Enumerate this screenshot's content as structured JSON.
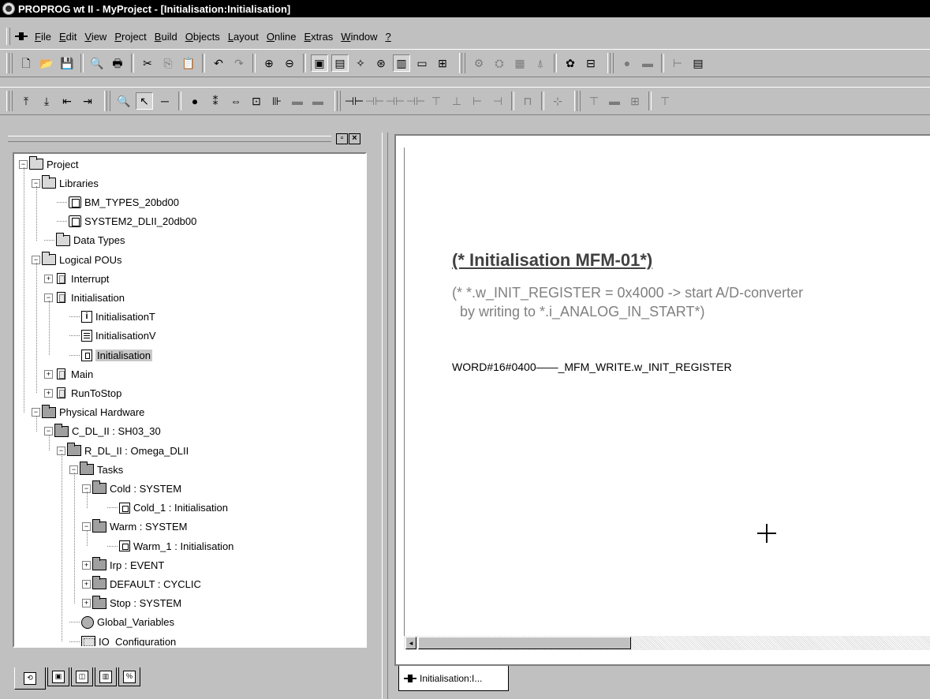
{
  "window": {
    "title": "PROPROG wt II - MyProject - [Initialisation:Initialisation]"
  },
  "menu": [
    {
      "id": "file",
      "label": "File"
    },
    {
      "id": "edit",
      "label": "Edit"
    },
    {
      "id": "view",
      "label": "View"
    },
    {
      "id": "project",
      "label": "Project"
    },
    {
      "id": "build",
      "label": "Build"
    },
    {
      "id": "objects",
      "label": "Objects"
    },
    {
      "id": "layout",
      "label": "Layout"
    },
    {
      "id": "online",
      "label": "Online"
    },
    {
      "id": "extras",
      "label": "Extras"
    },
    {
      "id": "window",
      "label": "Window"
    },
    {
      "id": "help",
      "label": "?"
    }
  ],
  "toolbar1": [
    {
      "name": "new-icon",
      "glyph": "🗋"
    },
    {
      "name": "open-icon",
      "glyph": "📂"
    },
    {
      "name": "save-icon",
      "glyph": "💾"
    },
    {
      "sep": true
    },
    {
      "name": "print-preview-icon",
      "glyph": "🔍"
    },
    {
      "name": "print-icon",
      "glyph": "🖶"
    },
    {
      "sep": true
    },
    {
      "name": "cut-icon",
      "glyph": "✂"
    },
    {
      "name": "copy-icon",
      "glyph": "⎘",
      "muted": true
    },
    {
      "name": "paste-icon",
      "glyph": "📋"
    },
    {
      "sep": true
    },
    {
      "name": "undo-icon",
      "glyph": "↶"
    },
    {
      "name": "redo-icon",
      "glyph": "↷",
      "muted": true
    },
    {
      "sep": true
    },
    {
      "name": "zoom-in-icon",
      "glyph": "⊕"
    },
    {
      "name": "zoom-out-icon",
      "glyph": "⊖"
    },
    {
      "sep": true
    },
    {
      "name": "project-tree-window-icon",
      "glyph": "▣",
      "pressed": true
    },
    {
      "name": "message-window-icon",
      "glyph": "▤",
      "pressed": true
    },
    {
      "name": "wizard-icon",
      "glyph": "✧"
    },
    {
      "name": "library-view-icon",
      "glyph": "⊛"
    },
    {
      "name": "task-view-icon",
      "glyph": "▥",
      "pressed": true
    },
    {
      "name": "window-icon",
      "glyph": "▭"
    },
    {
      "name": "compile-icon",
      "glyph": "⊞"
    },
    {
      "grip": true
    },
    {
      "name": "make-icon",
      "glyph": "⚙",
      "muted": true
    },
    {
      "name": "build-project-icon",
      "glyph": "⛭",
      "muted": true
    },
    {
      "name": "hardware-icon",
      "glyph": "▦",
      "muted": true
    },
    {
      "name": "download-icon",
      "glyph": "⍋",
      "muted": true
    },
    {
      "sep": true
    },
    {
      "name": "debug-icon",
      "glyph": "✿"
    },
    {
      "name": "monitor-icon",
      "glyph": "⊟"
    },
    {
      "grip": true
    },
    {
      "name": "run-icon",
      "glyph": "●",
      "muted": true
    },
    {
      "name": "stop-icon",
      "glyph": "▬",
      "muted": true
    },
    {
      "sep": true
    },
    {
      "name": "contact-icon",
      "glyph": "⊢",
      "muted": true
    },
    {
      "name": "terminal-icon",
      "glyph": "▤"
    }
  ],
  "toolbar2": [
    {
      "name": "insert-above-icon",
      "glyph": "⤒"
    },
    {
      "name": "insert-below-icon",
      "glyph": "⤓"
    },
    {
      "name": "insert-left-icon",
      "glyph": "⇤"
    },
    {
      "name": "insert-right-icon",
      "glyph": "⇥"
    },
    {
      "grip": true
    },
    {
      "name": "find-icon",
      "glyph": "🔍"
    },
    {
      "name": "select-pointer-icon",
      "glyph": "↖",
      "pressed": true
    },
    {
      "name": "line-tool-icon",
      "glyph": "─"
    },
    {
      "sep": true
    },
    {
      "name": "variable-icon",
      "glyph": "⦁"
    },
    {
      "name": "connector-icon",
      "glyph": "⁑"
    },
    {
      "name": "jump-icon",
      "glyph": "⇔"
    },
    {
      "name": "insert-fb-icon",
      "glyph": "⊡"
    },
    {
      "name": "function-block-icon",
      "glyph": "⊪"
    },
    {
      "name": "block-disabled-1-icon",
      "glyph": "▬",
      "muted": true
    },
    {
      "name": "block-disabled-2-icon",
      "glyph": "▬",
      "muted": true
    },
    {
      "grip": true
    },
    {
      "name": "coil-icon",
      "glyph": "⊣⊢"
    },
    {
      "name": "contact-no-icon",
      "glyph": "⊣⊢",
      "muted": true
    },
    {
      "name": "contact-nc-icon",
      "glyph": "⊣⊢",
      "muted": true
    },
    {
      "name": "contact-p-icon",
      "glyph": "⊣⊢",
      "muted": true
    },
    {
      "name": "contact-n-icon",
      "glyph": "⊤",
      "muted": true
    },
    {
      "name": "parallel-icon",
      "glyph": "⊥",
      "muted": true
    },
    {
      "name": "branch-icon",
      "glyph": "⊢",
      "muted": true
    },
    {
      "name": "branch-end-icon",
      "glyph": "⊣",
      "muted": true
    },
    {
      "sep": true
    },
    {
      "name": "rung-icon",
      "glyph": "⊓",
      "muted": true
    },
    {
      "sep": true
    },
    {
      "name": "network-icon",
      "glyph": "⊹",
      "muted": true
    },
    {
      "grip": true
    },
    {
      "name": "step-icon",
      "glyph": "⊤",
      "muted": true
    },
    {
      "name": "transition-icon",
      "glyph": "▬",
      "muted": true
    },
    {
      "name": "action-icon",
      "glyph": "⊞",
      "muted": true
    },
    {
      "sep": true
    },
    {
      "name": "sfc-branch-icon",
      "glyph": "⊤",
      "muted": true
    }
  ],
  "tree": [
    {
      "label": "Project",
      "level": 0,
      "expander": "−",
      "icon": "folder"
    },
    {
      "label": "Libraries",
      "level": 1,
      "expander": "−",
      "icon": "folder"
    },
    {
      "label": "BM_TYPES_20bd00",
      "level": 3,
      "icon": "lib"
    },
    {
      "label": "SYSTEM2_DLII_20db00",
      "level": 3,
      "icon": "lib"
    },
    {
      "label": "Data Types",
      "level": 2,
      "icon": "folder"
    },
    {
      "label": "Logical POUs",
      "level": 1,
      "expander": "−",
      "icon": "folder"
    },
    {
      "label": "Interrupt",
      "level": 2,
      "expander": "+",
      "icon": "pou"
    },
    {
      "label": "Initialisation",
      "level": 2,
      "expander": "−",
      "icon": "pou"
    },
    {
      "label": "InitialisationT",
      "level": 4,
      "icon": "info"
    },
    {
      "label": "InitialisationV",
      "level": 4,
      "icon": "list"
    },
    {
      "label": "Initialisation",
      "level": 4,
      "icon": "code",
      "selected": true
    },
    {
      "label": "Main",
      "level": 2,
      "expander": "+",
      "icon": "pou"
    },
    {
      "label": "RunToStop",
      "level": 2,
      "expander": "+",
      "icon": "pou"
    },
    {
      "label": "Physical Hardware",
      "level": 1,
      "expander": "−",
      "icon": "hw"
    },
    {
      "label": "C_DL_II : SH03_30",
      "level": 2,
      "expander": "−",
      "icon": "hw"
    },
    {
      "label": "R_DL_II : Omega_DLII",
      "level": 3,
      "expander": "−",
      "icon": "hw"
    },
    {
      "label": "Tasks",
      "level": 4,
      "expander": "−",
      "icon": "hw"
    },
    {
      "label": "Cold : SYSTEM",
      "level": 5,
      "expander": "−",
      "icon": "hw"
    },
    {
      "label": "Cold_1 : Initialisation",
      "level": 7,
      "icon": "task"
    },
    {
      "label": "Warm : SYSTEM",
      "level": 5,
      "expander": "−",
      "icon": "hw"
    },
    {
      "label": "Warm_1 : Initialisation",
      "level": 7,
      "icon": "task"
    },
    {
      "label": "Irp : EVENT",
      "level": 5,
      "expander": "+",
      "icon": "hw"
    },
    {
      "label": "DEFAULT : CYCLIC",
      "level": 5,
      "expander": "+",
      "icon": "hw"
    },
    {
      "label": "Stop : SYSTEM",
      "level": 5,
      "expander": "+",
      "icon": "hw"
    },
    {
      "label": "Global_Variables",
      "level": 4,
      "icon": "glob"
    },
    {
      "label": "IO_Configuration",
      "level": 4,
      "icon": "io"
    }
  ],
  "bottom_tabs": [
    {
      "name": "tab-project-tree",
      "glyph": "⟲"
    },
    {
      "name": "tab-data-types",
      "glyph": "▣"
    },
    {
      "name": "tab-libraries",
      "glyph": "◫"
    },
    {
      "name": "tab-hardware",
      "glyph": "▥"
    },
    {
      "name": "tab-io",
      "glyph": "%"
    }
  ],
  "editor": {
    "heading": "(* Initialisation MFM-01*)",
    "comment_line1": "(* *.w_INIT_REGISTER = 0x4000 -> start A/D-converter",
    "comment_line2": "  by writing to *.i_ANALOG_IN_START*)",
    "code_line": "WORD#16#0400——_MFM_WRITE.w_INIT_REGISTER"
  },
  "doc_tab": {
    "label": "Initialisation:I..."
  }
}
